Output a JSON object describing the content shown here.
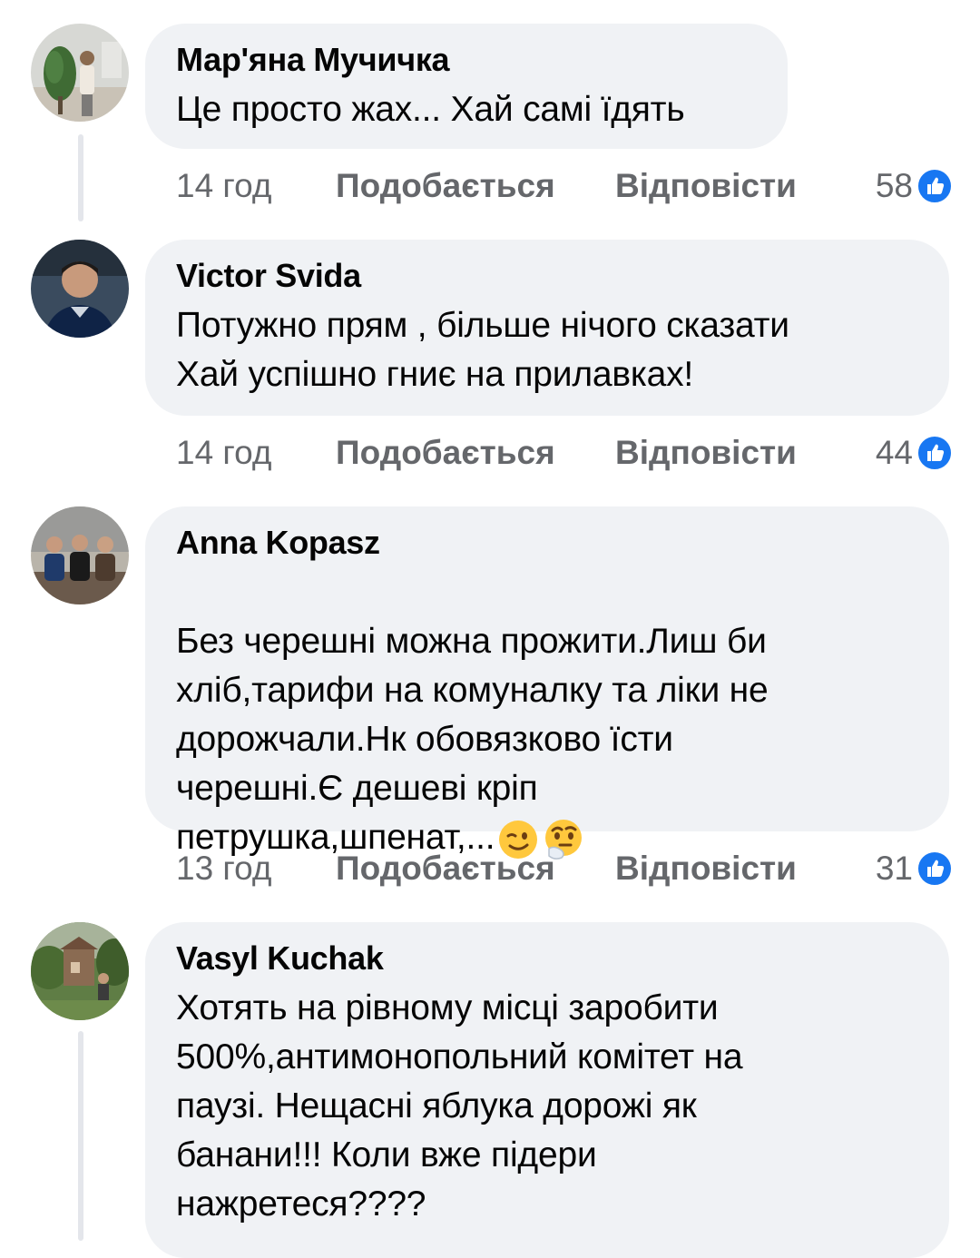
{
  "comments": [
    {
      "author": "Мар'яна Мучичка",
      "text": "Це просто жах... Хай самі їдять",
      "time": "14 год",
      "like_label": "Подобається",
      "reply_label": "Відповісти",
      "reactions": "58"
    },
    {
      "author": "Victor Svida",
      "text": "Потужно прям , більше нічого сказати\nХай успішно гниє на прилавках!",
      "time": "14 год",
      "like_label": "Подобається",
      "reply_label": "Відповісти",
      "reactions": "44"
    },
    {
      "author": "Anna Kopasz",
      "text": "Без черешні можна прожити.Лиш би\nхліб,тарифи на комуналку та ліки не\nдорожчали.Нк обовязково їсти\nчерешні.Є дешеві кріп\nпетрушка,шпенат,...",
      "time": "13 год",
      "like_label": "Подобається",
      "reply_label": "Відповісти",
      "reactions": "31",
      "emojis": [
        "winking-face",
        "thinking-face"
      ]
    },
    {
      "author": "Vasyl Kuchak",
      "text": "Хотять на рівному місці заробити\n500%,антимонопольний комітет на\nпаузі. Нещасні яблука дорожі як\nбанани!!! Коли вже підери\nнажретеся????"
    }
  ],
  "icons": {
    "reaction": "like-thumb-icon"
  },
  "colors": {
    "bubble": "#f0f2f5",
    "meta": "#65676b",
    "like_blue": "#1877f2"
  }
}
